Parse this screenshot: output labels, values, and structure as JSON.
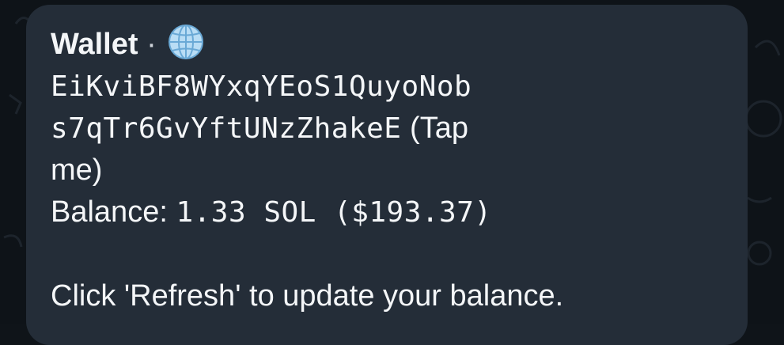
{
  "message": {
    "wallet_label": "Wallet",
    "separator": "·",
    "globe_icon": "globe-icon",
    "address_line1": "EiKviBF8WYxqYEoS1QuyoNob",
    "address_line2": "s7qTr6GvYftUNzZhakeE",
    "tap_hint_part1": "(Tap",
    "tap_hint_part2": "me)",
    "balance_label": "Balance:",
    "balance_value": "1.33 SOL ($193.37)",
    "refresh_hint": "Click 'Refresh' to update your balance."
  },
  "colors": {
    "chat_background": "#0e1318",
    "bubble_background": "#242d38",
    "text": "#f4f6f8"
  }
}
